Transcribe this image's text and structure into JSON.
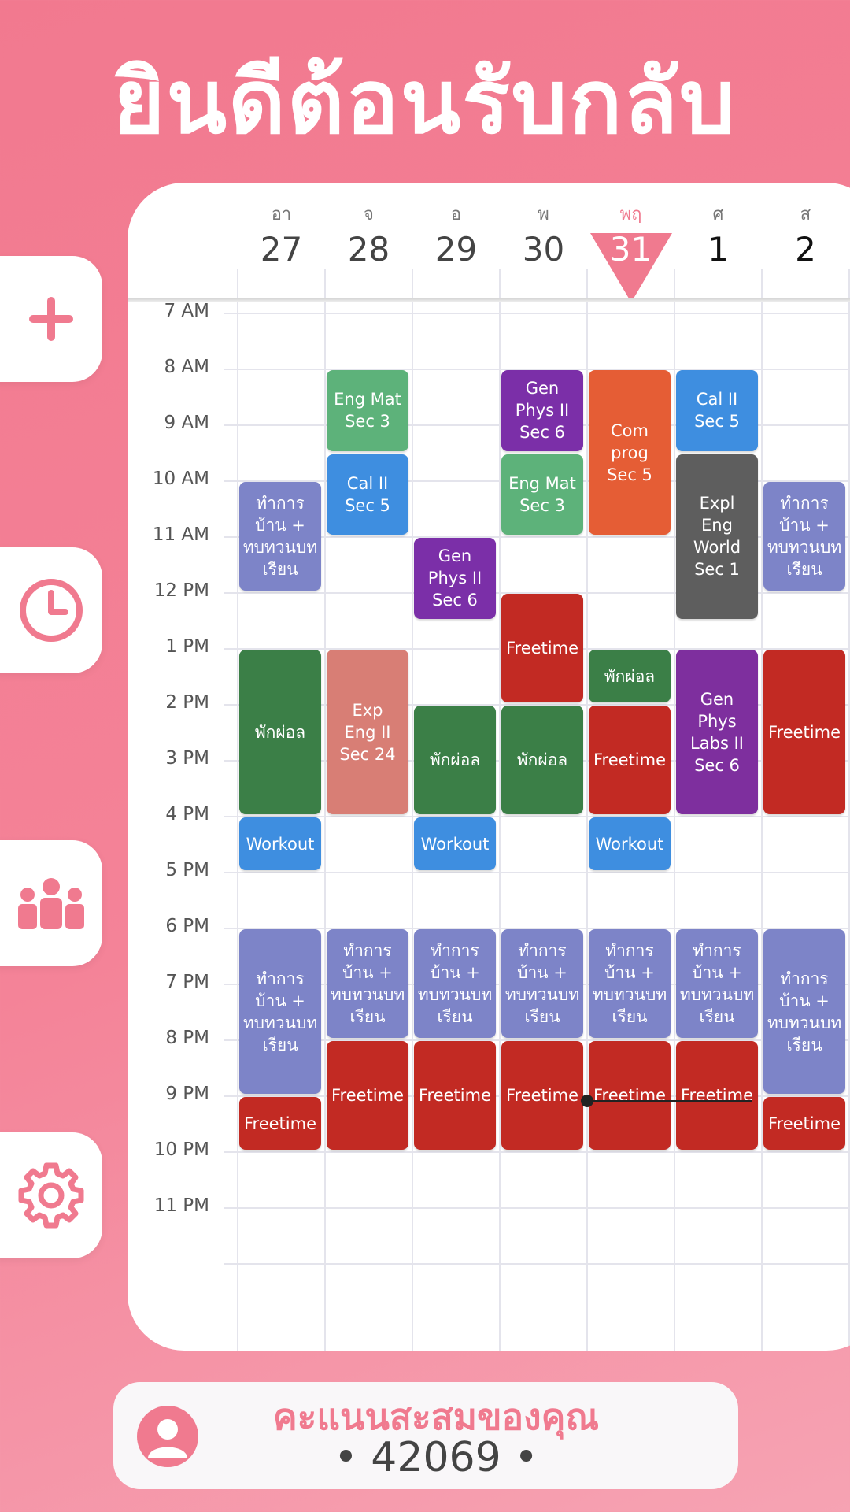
{
  "header": {
    "title": "ยินดีต้อนรับกลับ"
  },
  "sidebar": {
    "buttons": [
      {
        "name": "add-button",
        "icon": "plus-icon"
      },
      {
        "name": "history-button",
        "icon": "clock-icon"
      },
      {
        "name": "group-button",
        "icon": "group-icon"
      },
      {
        "name": "settings-button",
        "icon": "gear-icon"
      }
    ]
  },
  "calendar": {
    "days": [
      {
        "dow": "อา",
        "num": "27"
      },
      {
        "dow": "จ",
        "num": "28"
      },
      {
        "dow": "อ",
        "num": "29"
      },
      {
        "dow": "พ",
        "num": "30"
      },
      {
        "dow": "พฤ",
        "num": "31",
        "today": true
      },
      {
        "dow": "ศ",
        "num": "1"
      },
      {
        "dow": "ส",
        "num": "2"
      }
    ],
    "hours": [
      "7 AM",
      "8 AM",
      "9 AM",
      "10 AM",
      "11 AM",
      "12 PM",
      "1 PM",
      "2 PM",
      "3 PM",
      "4 PM",
      "5 PM",
      "6 PM",
      "7 PM",
      "8 PM",
      "9 PM",
      "10 PM",
      "11 PM"
    ],
    "now_time": "21:05",
    "colors": {
      "green_light": "#5db27a",
      "blue": "#3e8ee0",
      "purple": "#7b2fa8",
      "orange": "#e55d35",
      "gray": "#5e5e5e",
      "lavender": "#7d84c8",
      "red": "#c22a23",
      "green_dark": "#3b7f47",
      "salmon": "#d87e75",
      "violet": "#7e2f9e",
      "today_pink": "#f07a8f"
    },
    "events": [
      {
        "day": 0,
        "start": 10.0,
        "end": 12.0,
        "title": "ทำการ\nบ้าน +\nทบทวนบท\nเรียน",
        "color": "lavender"
      },
      {
        "day": 0,
        "start": 13.0,
        "end": 16.0,
        "title": "พักผ่อล",
        "color": "green_dark"
      },
      {
        "day": 0,
        "start": 16.0,
        "end": 17.0,
        "title": "Workout",
        "color": "blue"
      },
      {
        "day": 0,
        "start": 18.0,
        "end": 21.0,
        "title": "ทำการ\nบ้าน +\nทบทวนบท\nเรียน",
        "color": "lavender"
      },
      {
        "day": 0,
        "start": 21.0,
        "end": 22.0,
        "title": "Freetime",
        "color": "red"
      },
      {
        "day": 1,
        "start": 8.0,
        "end": 9.5,
        "title": "Eng Mat\nSec 3",
        "color": "green_light"
      },
      {
        "day": 1,
        "start": 9.5,
        "end": 11.0,
        "title": "Cal II\nSec 5",
        "color": "blue"
      },
      {
        "day": 1,
        "start": 13.0,
        "end": 16.0,
        "title": "Exp\nEng II\nSec 24",
        "color": "salmon"
      },
      {
        "day": 1,
        "start": 18.0,
        "end": 20.0,
        "title": "ทำการ\nบ้าน +\nทบทวนบท\nเรียน",
        "color": "lavender"
      },
      {
        "day": 1,
        "start": 20.0,
        "end": 22.0,
        "title": "Freetime",
        "color": "red"
      },
      {
        "day": 2,
        "start": 11.0,
        "end": 12.5,
        "title": "Gen\nPhys II\nSec 6",
        "color": "purple"
      },
      {
        "day": 2,
        "start": 14.0,
        "end": 16.0,
        "title": "พักผ่อล",
        "color": "green_dark"
      },
      {
        "day": 2,
        "start": 16.0,
        "end": 17.0,
        "title": "Workout",
        "color": "blue"
      },
      {
        "day": 2,
        "start": 18.0,
        "end": 20.0,
        "title": "ทำการ\nบ้าน +\nทบทวนบท\nเรียน",
        "color": "lavender"
      },
      {
        "day": 2,
        "start": 20.0,
        "end": 22.0,
        "title": "Freetime",
        "color": "red"
      },
      {
        "day": 3,
        "start": 8.0,
        "end": 9.5,
        "title": "Gen\nPhys II\nSec 6",
        "color": "purple"
      },
      {
        "day": 3,
        "start": 9.5,
        "end": 11.0,
        "title": "Eng Mat\nSec 3",
        "color": "green_light"
      },
      {
        "day": 3,
        "start": 12.0,
        "end": 14.0,
        "title": "Freetime",
        "color": "red"
      },
      {
        "day": 3,
        "start": 14.0,
        "end": 16.0,
        "title": "พักผ่อล",
        "color": "green_dark"
      },
      {
        "day": 3,
        "start": 18.0,
        "end": 20.0,
        "title": "ทำการ\nบ้าน +\nทบทวนบท\nเรียน",
        "color": "lavender"
      },
      {
        "day": 3,
        "start": 20.0,
        "end": 22.0,
        "title": "Freetime",
        "color": "red"
      },
      {
        "day": 4,
        "start": 8.0,
        "end": 11.0,
        "title": "Com\nprog\nSec 5",
        "color": "orange"
      },
      {
        "day": 4,
        "start": 13.0,
        "end": 14.0,
        "title": "พักผ่อล",
        "color": "green_dark"
      },
      {
        "day": 4,
        "start": 14.0,
        "end": 16.0,
        "title": "Freetime",
        "color": "red"
      },
      {
        "day": 4,
        "start": 16.0,
        "end": 17.0,
        "title": "Workout",
        "color": "blue"
      },
      {
        "day": 4,
        "start": 18.0,
        "end": 20.0,
        "title": "ทำการ\nบ้าน +\nทบทวนบท\nเรียน",
        "color": "lavender"
      },
      {
        "day": 4,
        "start": 20.0,
        "end": 22.0,
        "title": "Freetime",
        "color": "red"
      },
      {
        "day": 5,
        "start": 8.0,
        "end": 9.5,
        "title": "Cal II\nSec 5",
        "color": "blue"
      },
      {
        "day": 5,
        "start": 9.5,
        "end": 12.5,
        "title": "Expl\nEng\nWorld\nSec 1",
        "color": "gray"
      },
      {
        "day": 5,
        "start": 13.0,
        "end": 16.0,
        "title": "Gen\nPhys\nLabs II\nSec 6",
        "color": "violet"
      },
      {
        "day": 5,
        "start": 18.0,
        "end": 20.0,
        "title": "ทำการ\nบ้าน +\nทบทวนบท\nเรียน",
        "color": "lavender"
      },
      {
        "day": 5,
        "start": 20.0,
        "end": 22.0,
        "title": "Freetime",
        "color": "red"
      },
      {
        "day": 6,
        "start": 10.0,
        "end": 12.0,
        "title": "ทำการ\nบ้าน +\nทบทวนบท\nเรียน",
        "color": "lavender"
      },
      {
        "day": 6,
        "start": 13.0,
        "end": 16.0,
        "title": "Freetime",
        "color": "red"
      },
      {
        "day": 6,
        "start": 18.0,
        "end": 21.0,
        "title": "ทำการ\nบ้าน +\nทบทวนบท\nเรียน",
        "color": "lavender"
      },
      {
        "day": 6,
        "start": 21.0,
        "end": 22.0,
        "title": "Freetime",
        "color": "red"
      }
    ]
  },
  "score": {
    "label": "คะแนนสะสมของคุณ",
    "value": "• 42069 •"
  }
}
